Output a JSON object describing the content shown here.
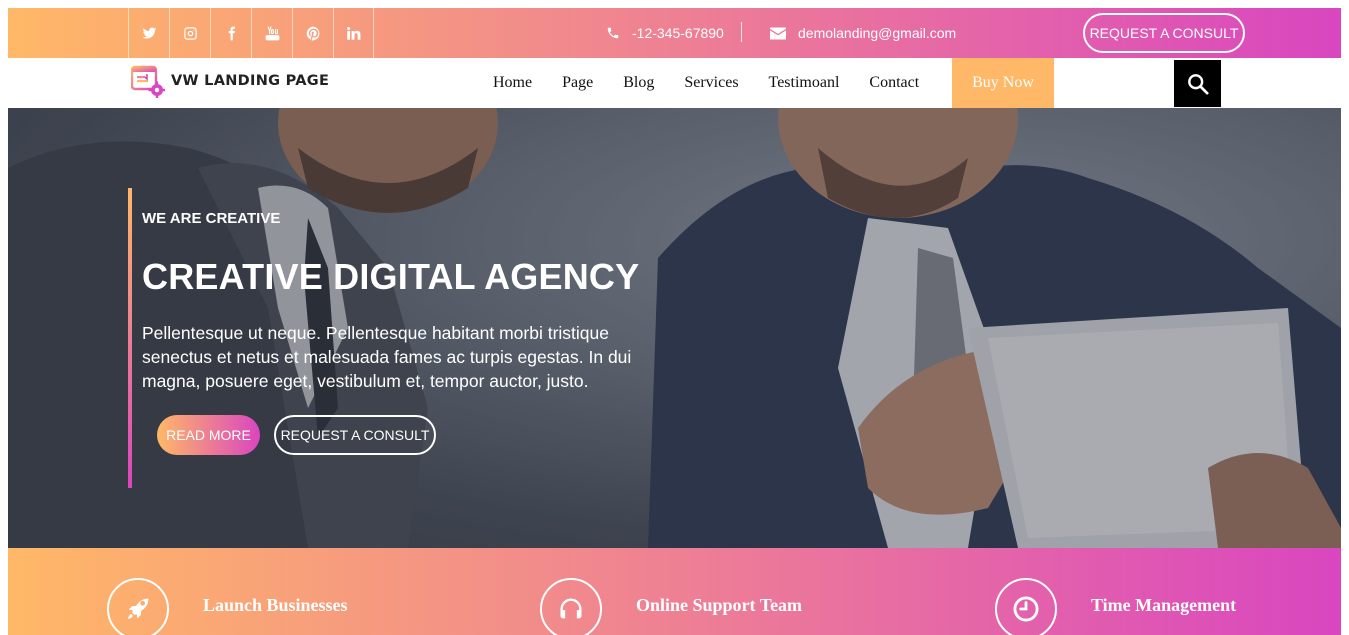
{
  "topbar": {
    "social_icons": [
      "twitter-icon",
      "instagram-icon",
      "facebook-icon",
      "youtube-icon",
      "pinterest-icon",
      "linkedin-icon"
    ],
    "phone": "-12-345-67890",
    "email": "demolanding@gmail.com",
    "consult_button": "REQUEST A CONSULT"
  },
  "nav": {
    "logo_text": "VW LANDING PAGE",
    "items": [
      "Home",
      "Page",
      "Blog",
      "Services",
      "Testimoanl",
      "Contact"
    ],
    "buy_now": "Buy Now"
  },
  "hero": {
    "kicker": "WE ARE CREATIVE",
    "title": "CREATIVE DIGITAL AGENCY",
    "text": "Pellentesque ut neque. Pellentesque habitant morbi tristique senectus et netus et malesuada fames ac turpis egestas. In dui magna, posuere eget, vestibulum et, tempor auctor, justo.",
    "read_more": "READ MORE",
    "consult": "REQUEST A CONSULT"
  },
  "features": [
    {
      "title": "Launch Businesses",
      "icon": "rocket-icon"
    },
    {
      "title": "Online Support Team",
      "icon": "headphones-icon"
    },
    {
      "title": "Time Management",
      "icon": "clock-icon"
    }
  ],
  "colors": {
    "gradient_start": "#ffb867",
    "gradient_end": "#d946c0",
    "buy_now_bg": "#ffb867"
  }
}
